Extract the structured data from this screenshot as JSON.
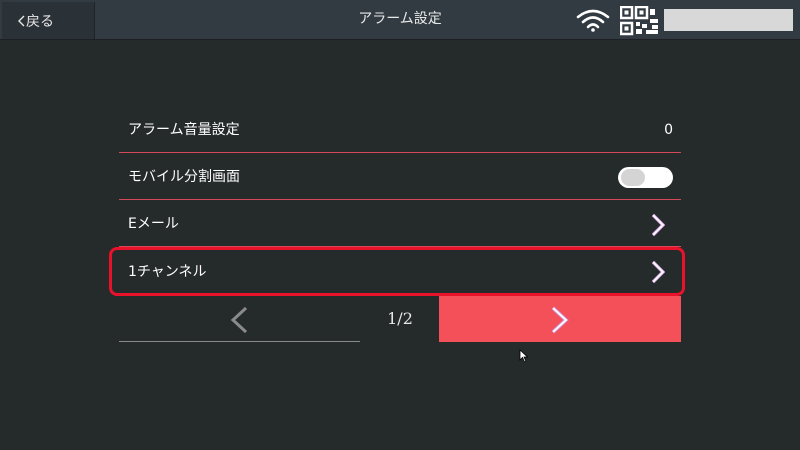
{
  "header": {
    "back_label": "戻る",
    "title": "アラーム設定"
  },
  "icons": {
    "back": "chevron-left-icon",
    "wifi": "wifi-icon",
    "qr": "qr-code-icon",
    "arrow": "chevron-right-icon",
    "prev": "chevron-left-icon"
  },
  "menu": {
    "items": [
      {
        "label": "アラーム音量設定",
        "value": "0"
      },
      {
        "label": "モバイル分割画面",
        "toggle": false
      },
      {
        "label": "Eメール"
      },
      {
        "label": "1チャンネル",
        "selected": true
      }
    ]
  },
  "pager": {
    "text": "1/2"
  },
  "colors": {
    "background": "#252a2b",
    "topbar": "#323b42",
    "accent": "#f3505a",
    "divider": "#d6485a",
    "highlight": "#e8122a"
  }
}
